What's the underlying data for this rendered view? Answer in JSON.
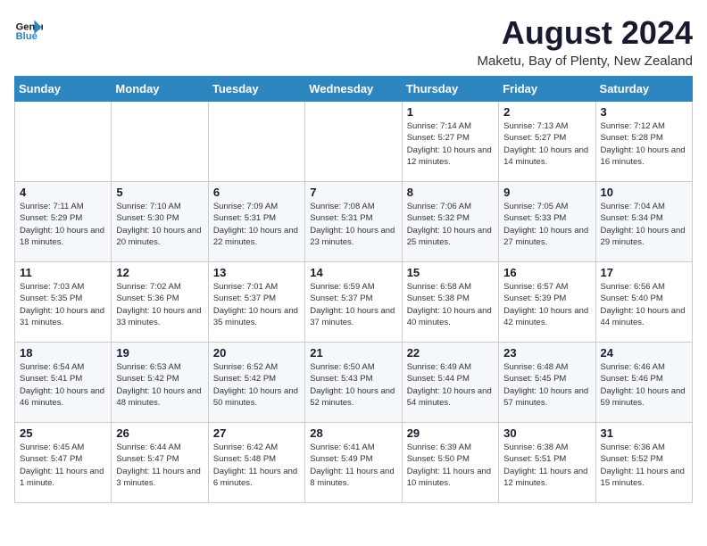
{
  "logo": {
    "line1": "General",
    "line2": "Blue"
  },
  "title": "August 2024",
  "subtitle": "Maketu, Bay of Plenty, New Zealand",
  "weekdays": [
    "Sunday",
    "Monday",
    "Tuesday",
    "Wednesday",
    "Thursday",
    "Friday",
    "Saturday"
  ],
  "weeks": [
    [
      {
        "day": "",
        "info": ""
      },
      {
        "day": "",
        "info": ""
      },
      {
        "day": "",
        "info": ""
      },
      {
        "day": "",
        "info": ""
      },
      {
        "day": "1",
        "info": "Sunrise: 7:14 AM\nSunset: 5:27 PM\nDaylight: 10 hours\nand 12 minutes."
      },
      {
        "day": "2",
        "info": "Sunrise: 7:13 AM\nSunset: 5:27 PM\nDaylight: 10 hours\nand 14 minutes."
      },
      {
        "day": "3",
        "info": "Sunrise: 7:12 AM\nSunset: 5:28 PM\nDaylight: 10 hours\nand 16 minutes."
      }
    ],
    [
      {
        "day": "4",
        "info": "Sunrise: 7:11 AM\nSunset: 5:29 PM\nDaylight: 10 hours\nand 18 minutes."
      },
      {
        "day": "5",
        "info": "Sunrise: 7:10 AM\nSunset: 5:30 PM\nDaylight: 10 hours\nand 20 minutes."
      },
      {
        "day": "6",
        "info": "Sunrise: 7:09 AM\nSunset: 5:31 PM\nDaylight: 10 hours\nand 22 minutes."
      },
      {
        "day": "7",
        "info": "Sunrise: 7:08 AM\nSunset: 5:31 PM\nDaylight: 10 hours\nand 23 minutes."
      },
      {
        "day": "8",
        "info": "Sunrise: 7:06 AM\nSunset: 5:32 PM\nDaylight: 10 hours\nand 25 minutes."
      },
      {
        "day": "9",
        "info": "Sunrise: 7:05 AM\nSunset: 5:33 PM\nDaylight: 10 hours\nand 27 minutes."
      },
      {
        "day": "10",
        "info": "Sunrise: 7:04 AM\nSunset: 5:34 PM\nDaylight: 10 hours\nand 29 minutes."
      }
    ],
    [
      {
        "day": "11",
        "info": "Sunrise: 7:03 AM\nSunset: 5:35 PM\nDaylight: 10 hours\nand 31 minutes."
      },
      {
        "day": "12",
        "info": "Sunrise: 7:02 AM\nSunset: 5:36 PM\nDaylight: 10 hours\nand 33 minutes."
      },
      {
        "day": "13",
        "info": "Sunrise: 7:01 AM\nSunset: 5:37 PM\nDaylight: 10 hours\nand 35 minutes."
      },
      {
        "day": "14",
        "info": "Sunrise: 6:59 AM\nSunset: 5:37 PM\nDaylight: 10 hours\nand 37 minutes."
      },
      {
        "day": "15",
        "info": "Sunrise: 6:58 AM\nSunset: 5:38 PM\nDaylight: 10 hours\nand 40 minutes."
      },
      {
        "day": "16",
        "info": "Sunrise: 6:57 AM\nSunset: 5:39 PM\nDaylight: 10 hours\nand 42 minutes."
      },
      {
        "day": "17",
        "info": "Sunrise: 6:56 AM\nSunset: 5:40 PM\nDaylight: 10 hours\nand 44 minutes."
      }
    ],
    [
      {
        "day": "18",
        "info": "Sunrise: 6:54 AM\nSunset: 5:41 PM\nDaylight: 10 hours\nand 46 minutes."
      },
      {
        "day": "19",
        "info": "Sunrise: 6:53 AM\nSunset: 5:42 PM\nDaylight: 10 hours\nand 48 minutes."
      },
      {
        "day": "20",
        "info": "Sunrise: 6:52 AM\nSunset: 5:42 PM\nDaylight: 10 hours\nand 50 minutes."
      },
      {
        "day": "21",
        "info": "Sunrise: 6:50 AM\nSunset: 5:43 PM\nDaylight: 10 hours\nand 52 minutes."
      },
      {
        "day": "22",
        "info": "Sunrise: 6:49 AM\nSunset: 5:44 PM\nDaylight: 10 hours\nand 54 minutes."
      },
      {
        "day": "23",
        "info": "Sunrise: 6:48 AM\nSunset: 5:45 PM\nDaylight: 10 hours\nand 57 minutes."
      },
      {
        "day": "24",
        "info": "Sunrise: 6:46 AM\nSunset: 5:46 PM\nDaylight: 10 hours\nand 59 minutes."
      }
    ],
    [
      {
        "day": "25",
        "info": "Sunrise: 6:45 AM\nSunset: 5:47 PM\nDaylight: 11 hours\nand 1 minute."
      },
      {
        "day": "26",
        "info": "Sunrise: 6:44 AM\nSunset: 5:47 PM\nDaylight: 11 hours\nand 3 minutes."
      },
      {
        "day": "27",
        "info": "Sunrise: 6:42 AM\nSunset: 5:48 PM\nDaylight: 11 hours\nand 6 minutes."
      },
      {
        "day": "28",
        "info": "Sunrise: 6:41 AM\nSunset: 5:49 PM\nDaylight: 11 hours\nand 8 minutes."
      },
      {
        "day": "29",
        "info": "Sunrise: 6:39 AM\nSunset: 5:50 PM\nDaylight: 11 hours\nand 10 minutes."
      },
      {
        "day": "30",
        "info": "Sunrise: 6:38 AM\nSunset: 5:51 PM\nDaylight: 11 hours\nand 12 minutes."
      },
      {
        "day": "31",
        "info": "Sunrise: 6:36 AM\nSunset: 5:52 PM\nDaylight: 11 hours\nand 15 minutes."
      }
    ]
  ]
}
